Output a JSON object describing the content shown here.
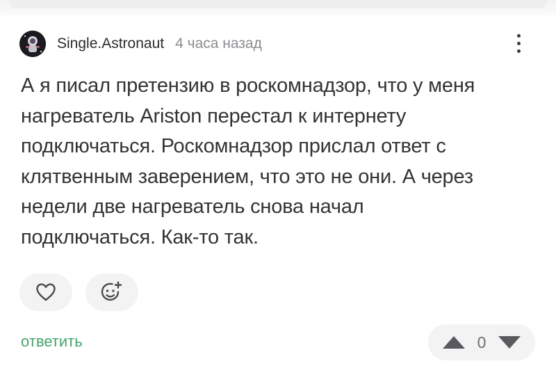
{
  "comment": {
    "author": "Single.Astronaut",
    "time": "4 часа назад",
    "lines": [
      "А я писал претензию в роскомнадзор, что у меня",
      "нагреватель Ariston перестал к интернету",
      "подключаться. Роскомнадзор прислал ответ с",
      "клятвенным заверением, что это не они. А через",
      "недели две нагреватель снова начал",
      "подключаться. Как-то так."
    ],
    "reply_label": "ответить",
    "vote_count": "0"
  },
  "icons": {
    "like": "heart-icon",
    "add_reaction": "add-emoji-icon",
    "more": "more-vertical-icon",
    "upvote": "triangle-up-icon",
    "downvote": "triangle-down-icon"
  },
  "colors": {
    "reply_link": "#46a46a",
    "text": "#333336",
    "muted": "#8b8b90",
    "reaction_bg": "#f3f3f4"
  }
}
